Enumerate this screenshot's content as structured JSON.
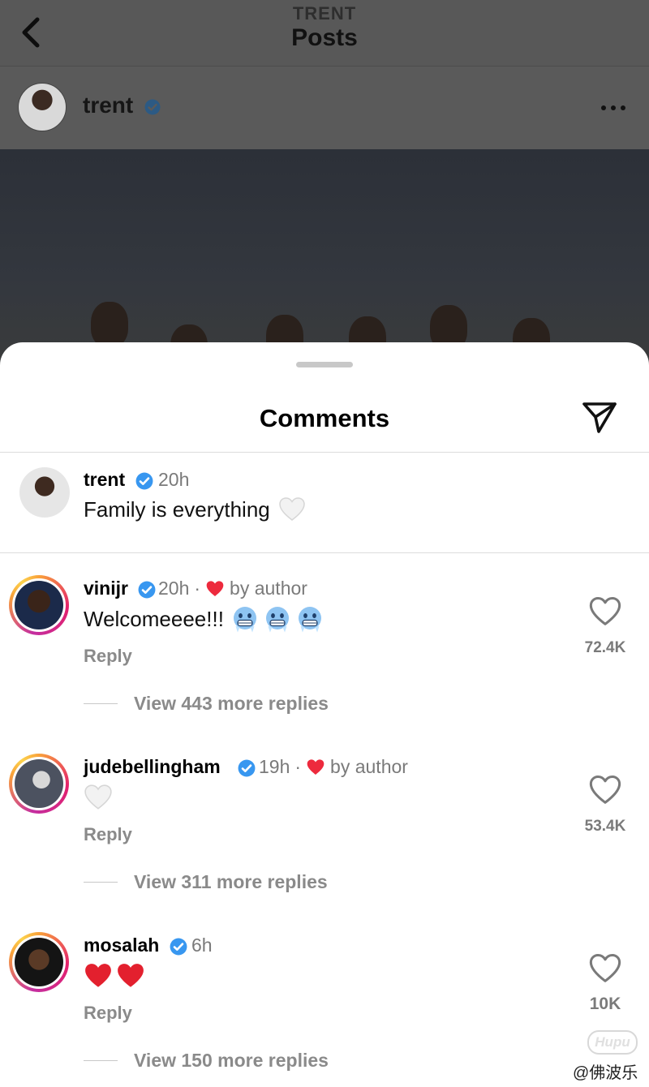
{
  "header": {
    "subtitle": "TRENT",
    "title": "Posts",
    "back_icon": "chevron-left-icon"
  },
  "post": {
    "username": "trent",
    "verified": true,
    "more_icon": "more-horizontal-icon"
  },
  "comments_sheet": {
    "title": "Comments",
    "share_icon": "send-icon",
    "caption": {
      "username": "trent",
      "time": "20h",
      "text": "Family is everything",
      "emoji": "white-heart"
    },
    "comments": [
      {
        "username": "vinijr",
        "time": "20h",
        "separator": "·",
        "liked_by_author": "by author",
        "text": "Welcomeeee!!!",
        "emojis": [
          "cold-face",
          "cold-face",
          "cold-face"
        ],
        "reply_label": "Reply",
        "view_replies": "View 443 more replies",
        "like_count": "72.4K"
      },
      {
        "username": "judebellingham",
        "time": "19h",
        "separator": "·",
        "liked_by_author": "by author",
        "text": "",
        "emojis": [
          "white-heart"
        ],
        "reply_label": "Reply",
        "view_replies": "View 311 more replies",
        "like_count": "53.4K"
      },
      {
        "username": "mosalah",
        "time": "6h",
        "separator": "",
        "liked_by_author": "",
        "text": "",
        "emojis": [
          "red-heart",
          "red-heart"
        ],
        "reply_label": "Reply",
        "view_replies": "View 150 more replies",
        "like_count": "10K"
      }
    ]
  },
  "watermark": {
    "logo": "Hupu",
    "text": "@佛波乐"
  },
  "colors": {
    "verified_blue": "#3897f0",
    "heart_red": "#ed2a3d",
    "muted_text": "#7a7a7a"
  }
}
